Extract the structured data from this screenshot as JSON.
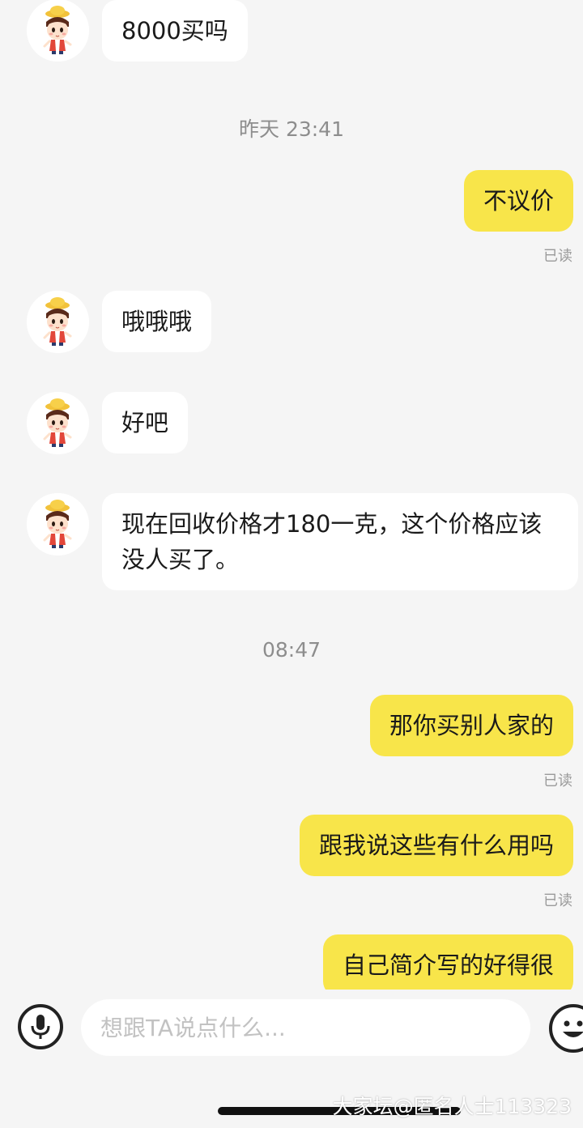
{
  "messages": [
    {
      "text": "8000买吗"
    },
    {
      "time": "昨天 23:41"
    },
    {
      "text": "不议价",
      "status": "已读"
    },
    {
      "text": "哦哦哦"
    },
    {
      "text": "好吧"
    },
    {
      "text": "现在回收价格才180一克，这个价格应该没人买了。"
    },
    {
      "time": "08:47"
    },
    {
      "text": "那你买别人家的",
      "status": "已读"
    },
    {
      "text": "跟我说这些有什么用吗",
      "status": "已读"
    },
    {
      "text": "自己简介写的好得很"
    }
  ],
  "input": {
    "placeholder": "想跟TA说点什么..."
  },
  "icons": {
    "voice": "microphone-icon",
    "emoji": "smiley-icon",
    "avatar": "cartoon-boy-avatar"
  },
  "colors": {
    "outgoing_bubble": "#f8e54a",
    "incoming_bubble": "#ffffff",
    "background": "#f5f5f5"
  },
  "watermark": "大家坛@匿名人士113323"
}
